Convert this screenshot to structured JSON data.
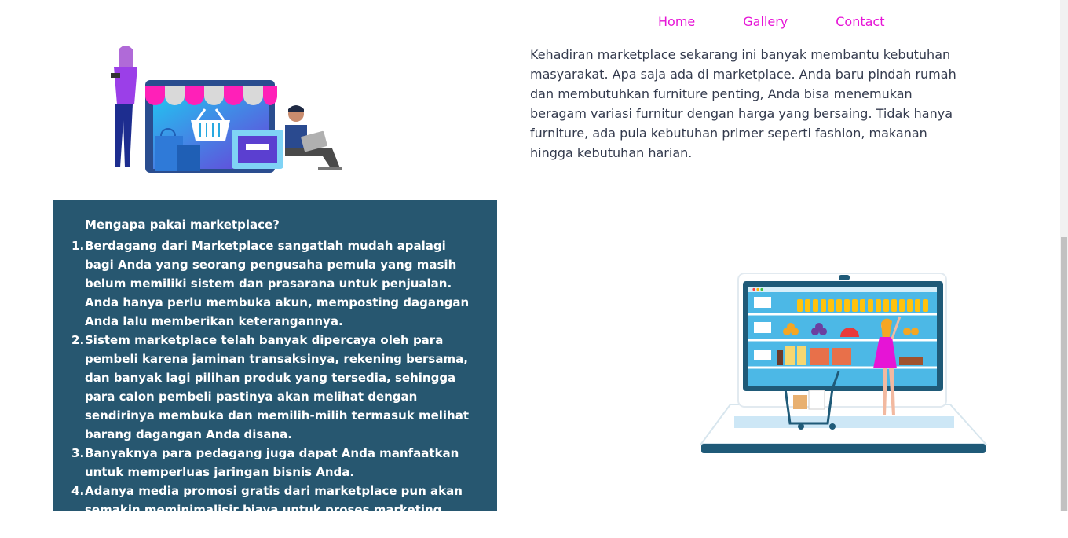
{
  "nav": {
    "home": "Home",
    "gallery": "Gallery",
    "contact": "Contact"
  },
  "intro": {
    "text": "Kehadiran marketplace sekarang ini banyak membantu kebutuhan masyarakat. Apa saja ada di marketplace. Anda baru pindah rumah dan membutuhkan furniture penting, Anda bisa menemukan beragam variasi furnitur dengan harga yang bersaing. Tidak hanya furniture, ada pula kebutuhan primer seperti fashion, makanan hingga kebutuhan harian."
  },
  "panel": {
    "heading": "Mengapa pakai marketplace?",
    "items": [
      "Berdagang dari Marketplace sangatlah mudah apalagi bagi Anda yang seorang pengusaha pemula yang masih belum memiliki sistem dan prasarana untuk penjualan. Anda hanya perlu membuka akun, memposting dagangan Anda lalu memberikan keterangannya.",
      "Sistem marketplace telah banyak dipercaya oleh para pembeli karena jaminan transaksinya, rekening bersama, dan banyak lagi pilihan produk yang tersedia, sehingga para calon pembeli pastinya akan melihat dengan sendirinya membuka dan memilih-milih termasuk melihat barang dagangan Anda disana.",
      "Banyaknya para pedagang juga dapat Anda manfaatkan untuk memperluas jaringan bisnis Anda.",
      "Adanya media promosi gratis dari marketplace pun akan semakin meminimalisir biaya untuk proses marketing Anda"
    ]
  },
  "colors": {
    "nav_link": "#e614d6",
    "panel_bg": "#275770",
    "body_text": "#333a4d"
  }
}
